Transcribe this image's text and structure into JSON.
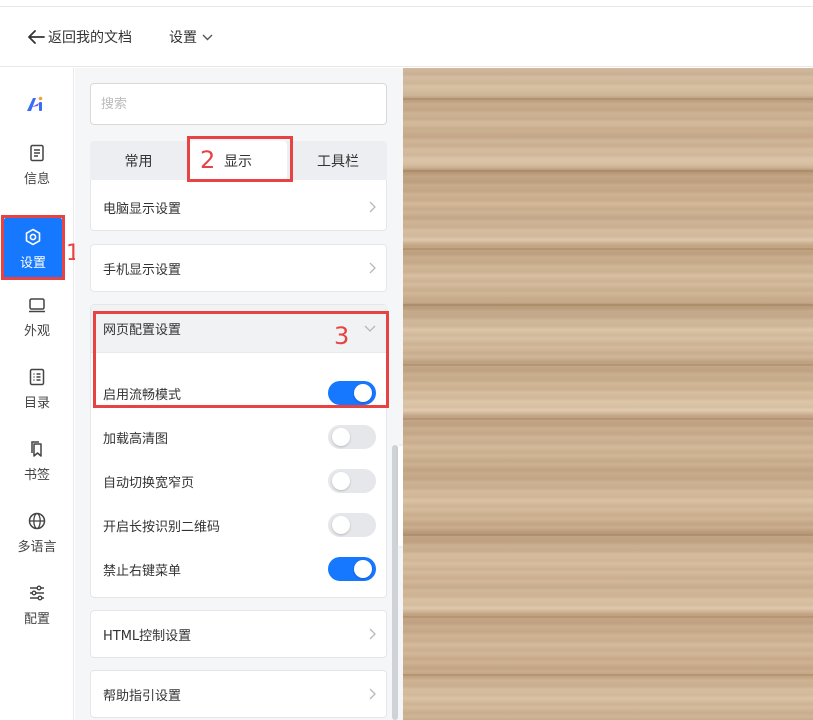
{
  "header": {
    "back_label": "返回我的文档",
    "settings_label": "设置"
  },
  "sidebar": {
    "logo": "ai-logo-icon",
    "items": [
      {
        "label": "信息",
        "icon": "document-icon",
        "active": false
      },
      {
        "label": "设置",
        "icon": "gear-hex-icon",
        "active": true
      },
      {
        "label": "外观",
        "icon": "monitor-icon",
        "active": false
      },
      {
        "label": "目录",
        "icon": "list-icon",
        "active": false
      },
      {
        "label": "书签",
        "icon": "bookmark-icon",
        "active": false
      },
      {
        "label": "多语言",
        "icon": "globe-icon",
        "active": false
      },
      {
        "label": "配置",
        "icon": "sliders-icon",
        "active": false
      }
    ]
  },
  "annotations": {
    "one": "1",
    "two": "2",
    "three": "3"
  },
  "panel": {
    "search_placeholder": "搜索",
    "tabs": [
      {
        "label": "常用",
        "active": false
      },
      {
        "label": "显示",
        "active": true
      },
      {
        "label": "工具栏",
        "active": false
      }
    ],
    "pc_display": "电脑显示设置",
    "mobile_display": "手机显示设置",
    "web_config": {
      "title": "网页配置设置",
      "toggles": [
        {
          "label": "启用流畅模式",
          "on": true
        },
        {
          "label": "加载高清图",
          "on": false
        },
        {
          "label": "自动切换宽窄页",
          "on": false
        },
        {
          "label": "开启长按识别二维码",
          "on": false
        },
        {
          "label": "禁止右键菜单",
          "on": true
        }
      ]
    },
    "html_control": "HTML控制设置",
    "help_guide": "帮助指引设置"
  },
  "colors": {
    "accent": "#1677ff",
    "annotation": "#e84343",
    "panel_bg": "#f5f6f8"
  }
}
